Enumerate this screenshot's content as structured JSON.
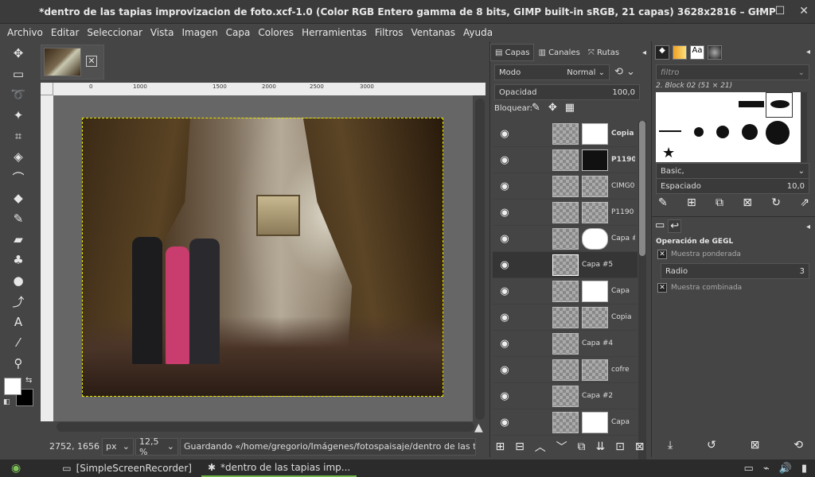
{
  "window": {
    "title": "*dentro de las tapias improvizacion de foto.xcf-1.0 (Color RGB Entero gamma de 8 bits, GIMP built-in sRGB, 21 capas) 3628x2816 – GIMP"
  },
  "menu": [
    "Archivo",
    "Editar",
    "Seleccionar",
    "Vista",
    "Imagen",
    "Capa",
    "Colores",
    "Herramientas",
    "Filtros",
    "Ventanas",
    "Ayuda"
  ],
  "ruler_ticks": [
    "0",
    "1000",
    "1500",
    "2000",
    "2500",
    "3000"
  ],
  "status": {
    "coords": "2752, 1656",
    "unit": "px",
    "zoom": "12,5 %",
    "message": "Guardando «/home/gregorio/Imágenes/fotospaisaje/dentro de las tapia..."
  },
  "layers_panel": {
    "tabs": [
      "Capas",
      "Canales",
      "Rutas"
    ],
    "mode_label": "Modo",
    "mode_value": "Normal",
    "opacity_label": "Opacidad",
    "opacity_value": "100,0",
    "lock_label": "Bloquear:",
    "layers": [
      {
        "name": "Copia",
        "bold": true
      },
      {
        "name": "P1190",
        "bold": true
      },
      {
        "name": "CIMG0",
        "bold": false
      },
      {
        "name": "P1190",
        "bold": false
      },
      {
        "name": "Capa #",
        "bold": false
      },
      {
        "name": "Capa #5",
        "bold": false
      },
      {
        "name": "Capa",
        "bold": false
      },
      {
        "name": "Copia",
        "bold": false
      },
      {
        "name": "Capa #4",
        "bold": false
      },
      {
        "name": "cofre",
        "bold": false
      },
      {
        "name": "Capa #2",
        "bold": false
      },
      {
        "name": "Capa",
        "bold": false
      }
    ]
  },
  "brushes_panel": {
    "filter_placeholder": "filtro",
    "brush_name": "2. Block 02 (51 × 21)",
    "preset": "Basic,",
    "spacing_label": "Espaciado",
    "spacing_value": "10,0"
  },
  "gegl_panel": {
    "title": "Operación de GEGL",
    "opt1": "Muestra ponderada",
    "radius_label": "Radio",
    "radius_value": "3",
    "opt2": "Muestra combinada"
  },
  "taskbar": {
    "item1": "[SimpleScreenRecorder]",
    "item2": "*dentro de las tapias imp..."
  }
}
